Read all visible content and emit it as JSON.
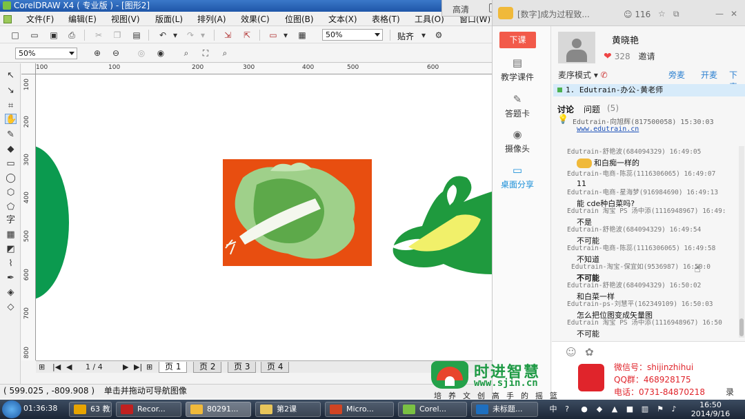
{
  "corel": {
    "title": "CorelDRAW X4 ( 专业版 ) - [图形2]",
    "menu": [
      "文件(F)",
      "编辑(E)",
      "视图(V)",
      "版面(L)",
      "排列(A)",
      "效果(C)",
      "位图(B)",
      "文本(X)",
      "表格(T)",
      "工具(O)",
      "窗口(W)"
    ],
    "zoom_main": "50%",
    "snap_label": "贴齐",
    "zoom_secondary": "50%",
    "overlay_buttons": [
      "高清",
      "结束"
    ],
    "ruler_h": [
      "100",
      "0",
      "100",
      "200",
      "300",
      "400",
      "500",
      "600"
    ],
    "ruler_v": [
      "100",
      "200",
      "300",
      "400",
      "500",
      "600",
      "700",
      "800"
    ],
    "page_counter": "1 / 4",
    "pages": [
      "页 1",
      "页 2",
      "页 3",
      "页 4"
    ],
    "status_coords": "( 599.025 , -809.908 )",
    "status_hint": "单击并拖动可导航图像",
    "colors": {
      "green_shape": "#0b9a4f",
      "orange_bg": "#e84e10",
      "leaf_green": "#1f9a3e",
      "yellow": "#f1f06a"
    }
  },
  "classroom": {
    "title": "[数字]成为过程致...",
    "online_count": "116",
    "leave_button": "下课",
    "side_items": [
      "教学课件",
      "答题卡",
      "摄像头",
      "桌面分享"
    ],
    "teacher": {
      "name": "黄晓艳",
      "likes": "328",
      "invite": "邀请"
    },
    "mic_mode": "麦序模式",
    "mic_actions": [
      "旁麦",
      "开麦",
      "下麦"
    ],
    "queue_entry": "1. Edutrain-办公-黄老师",
    "tabs": {
      "discuss": "讨论",
      "questions": "问题",
      "question_count": "(5)"
    },
    "notice": {
      "sender": "Edutrain-向旭辉(817500058) 15:30:03",
      "link": "www.edutrain.cn"
    },
    "messages": [
      {
        "meta": "Edutrain-舒艳波(684094329) 16:49:05",
        "text": "和白痴一样的",
        "emoji": true
      },
      {
        "meta": "Edutrain-电商-陈蕊(1116306065) 16:49:07",
        "text": "11"
      },
      {
        "meta": "Edutrain-电商-星海梦(916984690) 16:49:13",
        "text": "能        cde种白菜吗?"
      },
      {
        "meta": "Edutrain 淘宝 PS    汤中添(1116948967) 16:49:",
        "text": "不是"
      },
      {
        "meta": "Edutrain-舒艳波(684094329) 16:49:54",
        "text": "不可能"
      },
      {
        "meta": "Edutrain-电商-陈蕊(1116306065) 16:49:58",
        "text": "不知道"
      },
      {
        "meta": "Edutrain-淘宝-保宜如(9536987) 16:50:0",
        "text": "不可能",
        "bold": true
      },
      {
        "meta": "Edutrain-舒艳波(684094329) 16:50:02",
        "text": "和白菜一样"
      },
      {
        "meta": "Edutrain-ps-刘慧平(162349109) 16:50:03",
        "text": "怎么把位图变成矢量图"
      },
      {
        "meta": "Edutrain 淘宝 PS    汤中添(1116948967) 16:50",
        "text": "不可能"
      }
    ]
  },
  "watermark": {
    "brand_name": "时进智慧",
    "url": "www.sjin.cn",
    "slogan": "培养文创高手的摇篮",
    "wechat": "微信号：shijinzhihui",
    "qq": "QQ群：468928175",
    "phone": "电话：0731-84870218",
    "record_label": "录音"
  },
  "taskbar": {
    "rec_time": "01:36:38",
    "apps": [
      "63 教...",
      "Recor...",
      "80291...",
      "第2课",
      "Micro...",
      "Corel...",
      "未标题..."
    ],
    "time": "16:50",
    "date": "2014/9/16"
  }
}
